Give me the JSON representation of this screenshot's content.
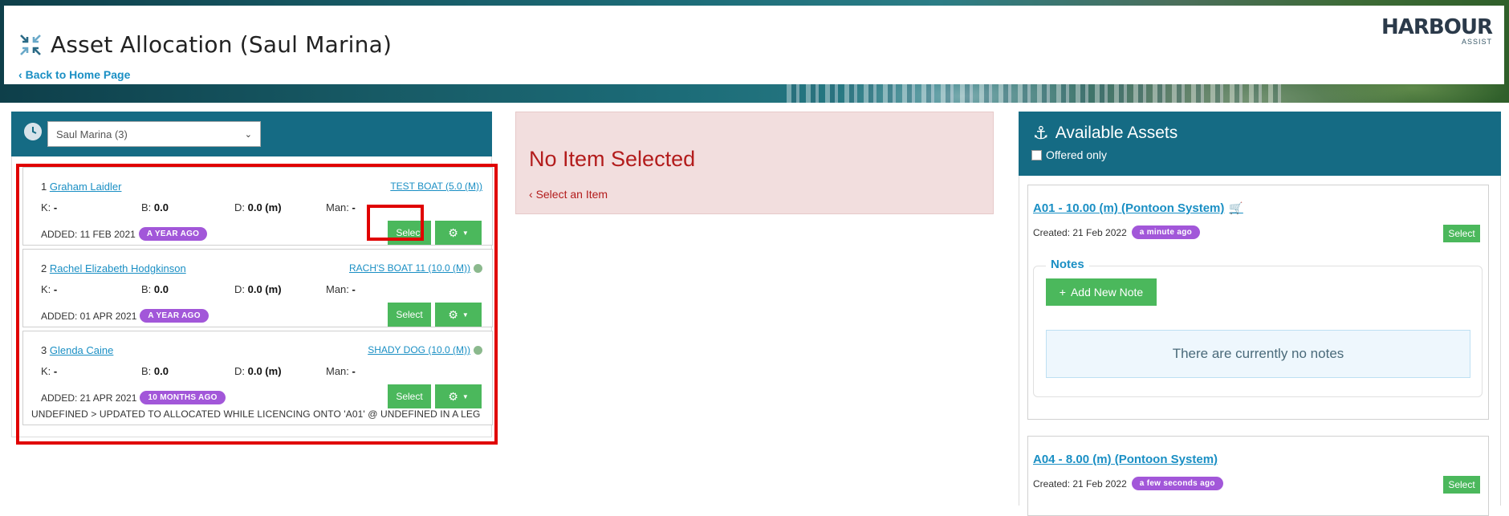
{
  "header": {
    "title": "Asset Allocation (Saul Marina)",
    "back_link": "Back to Home Page",
    "logo_text": "HARBOUR",
    "logo_sub": "ASSIST",
    "icon": "compress-arrows-icon"
  },
  "queue": {
    "selected_marina": "Saul Marina (3)",
    "items": [
      {
        "index": "1",
        "name": "Graham Laidler",
        "boat": "TEST BOAT (5.0 (M))",
        "k_label": "K:",
        "k_value": "-",
        "b_label": "B:",
        "b_value": "0.0",
        "d_label": "D:",
        "d_value": "0.0 (m)",
        "man_label": "Man:",
        "man_value": "-",
        "added": "ADDED: 11 FEB 2021",
        "age_badge": "A YEAR AGO",
        "select_label": "Select"
      },
      {
        "index": "2",
        "name": "Rachel Elizabeth Hodgkinson",
        "boat": "RACH'S BOAT 11 (10.0 (M))",
        "k_label": "K:",
        "k_value": "-",
        "b_label": "B:",
        "b_value": "0.0",
        "d_label": "D:",
        "d_value": "0.0 (m)",
        "man_label": "Man:",
        "man_value": "-",
        "added": "ADDED: 01 APR 2021",
        "age_badge": "A YEAR AGO",
        "select_label": "Select"
      },
      {
        "index": "3",
        "name": "Glenda Caine",
        "boat": "SHADY DOG (10.0 (M))",
        "k_label": "K:",
        "k_value": "-",
        "b_label": "B:",
        "b_value": "0.0",
        "d_label": "D:",
        "d_value": "0.0 (m)",
        "man_label": "Man:",
        "man_value": "-",
        "added": "ADDED: 21 APR 2021",
        "age_badge": "10 MONTHS AGO",
        "select_label": "Select",
        "note": "UNDEFINED > UPDATED TO ALLOCATED WHILE LICENCING ONTO 'A01' @ UNDEFINED IN A LEG"
      }
    ]
  },
  "detail": {
    "title": "No Item Selected",
    "hint": "Select an Item"
  },
  "assets": {
    "title": "Available Assets",
    "offered_only_label": "Offered only",
    "items": [
      {
        "title": "A01 - 10.00 (m) (Pontoon System)",
        "created": "Created: 21 Feb 2022",
        "age_badge": "a minute ago",
        "select_label": "Select",
        "notes_legend": "Notes",
        "add_note_label": "Add New Note",
        "empty_notes": "There are currently no notes"
      },
      {
        "title": "A04 - 8.00 (m) (Pontoon System)",
        "created": "Created: 21 Feb 2022",
        "age_badge": "a few seconds ago",
        "select_label": "Select"
      }
    ]
  },
  "colors": {
    "accent_teal": "#156b84",
    "link_blue": "#1a8fc4",
    "button_green": "#4bb85c",
    "badge_purple": "#a257d9",
    "alert_red": "#b31c1c",
    "highlight_red": "#e00000"
  }
}
